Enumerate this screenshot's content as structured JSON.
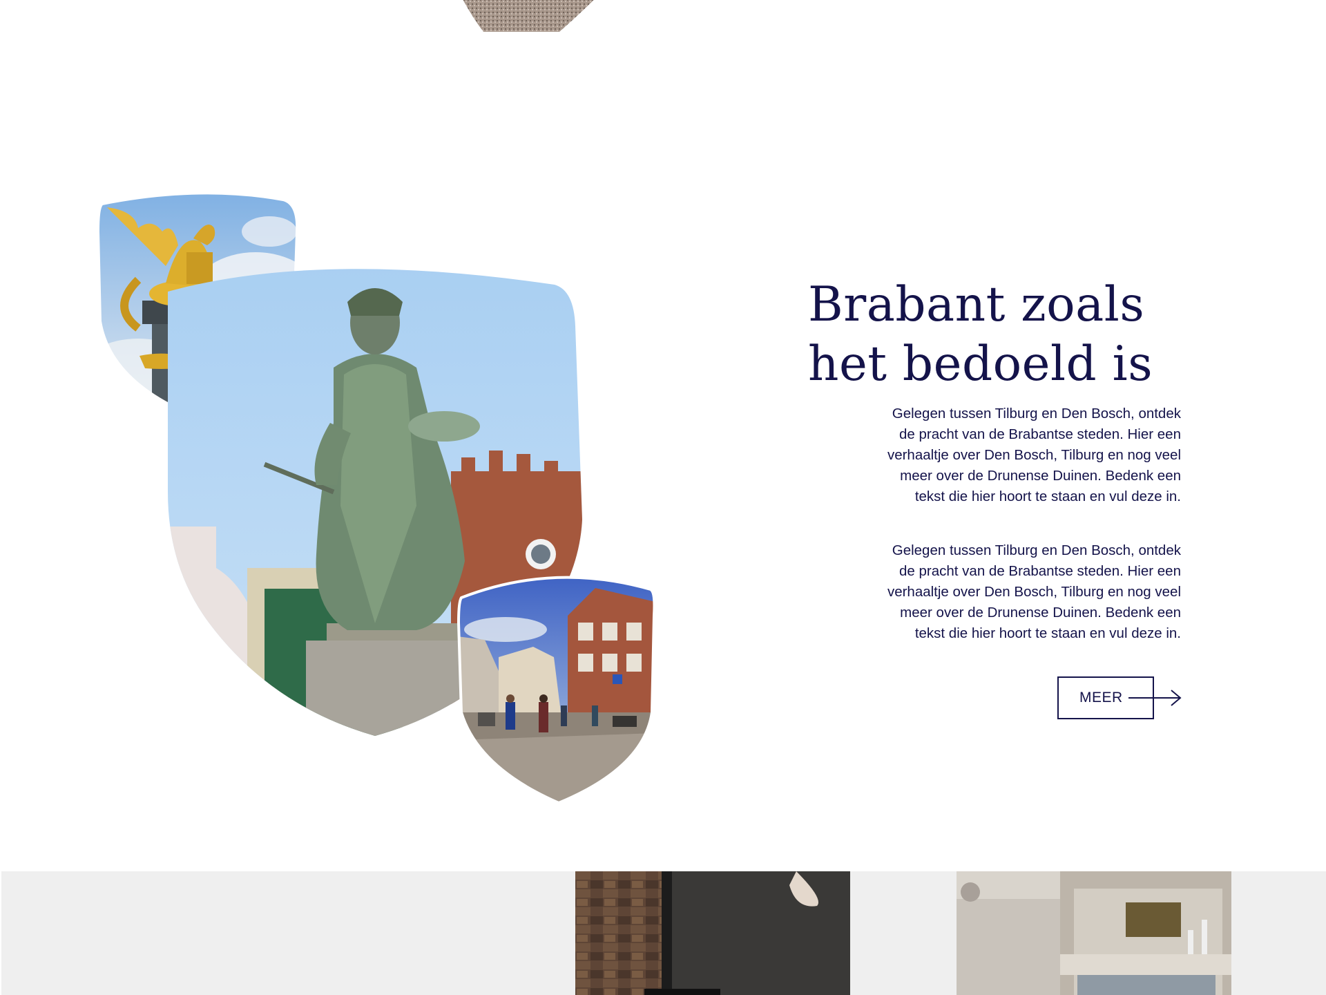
{
  "intro": {
    "heading_line1": "Brabant zoals",
    "heading_line2": "het bedoeld is",
    "paragraph1": "Gelegen tussen Tilburg en Den Bosch, ontdek de pracht van de Brabantse steden. Hier een verhaaltje over Den Bosch, Tilburg en nog veel meer over de Drunense Duinen. Bedenk een tekst die hier hoort te staan en vul deze in.",
    "paragraph2": "Gelegen tussen Tilburg en Den Bosch, ontdek de pracht van de Brabantse steden. Hier een verhaaltje over Den Bosch, Tilburg en nog veel meer over de Drunense Duinen. Bedenk een tekst die hier hoort te staan en vul deze in.",
    "button_label": "MEER"
  },
  "icons": {
    "button_arrow": "arrow-right-icon"
  },
  "colors": {
    "brand_navy": "#14134a",
    "band_gray": "#efefef",
    "sky_blue": "#a9cff2"
  }
}
